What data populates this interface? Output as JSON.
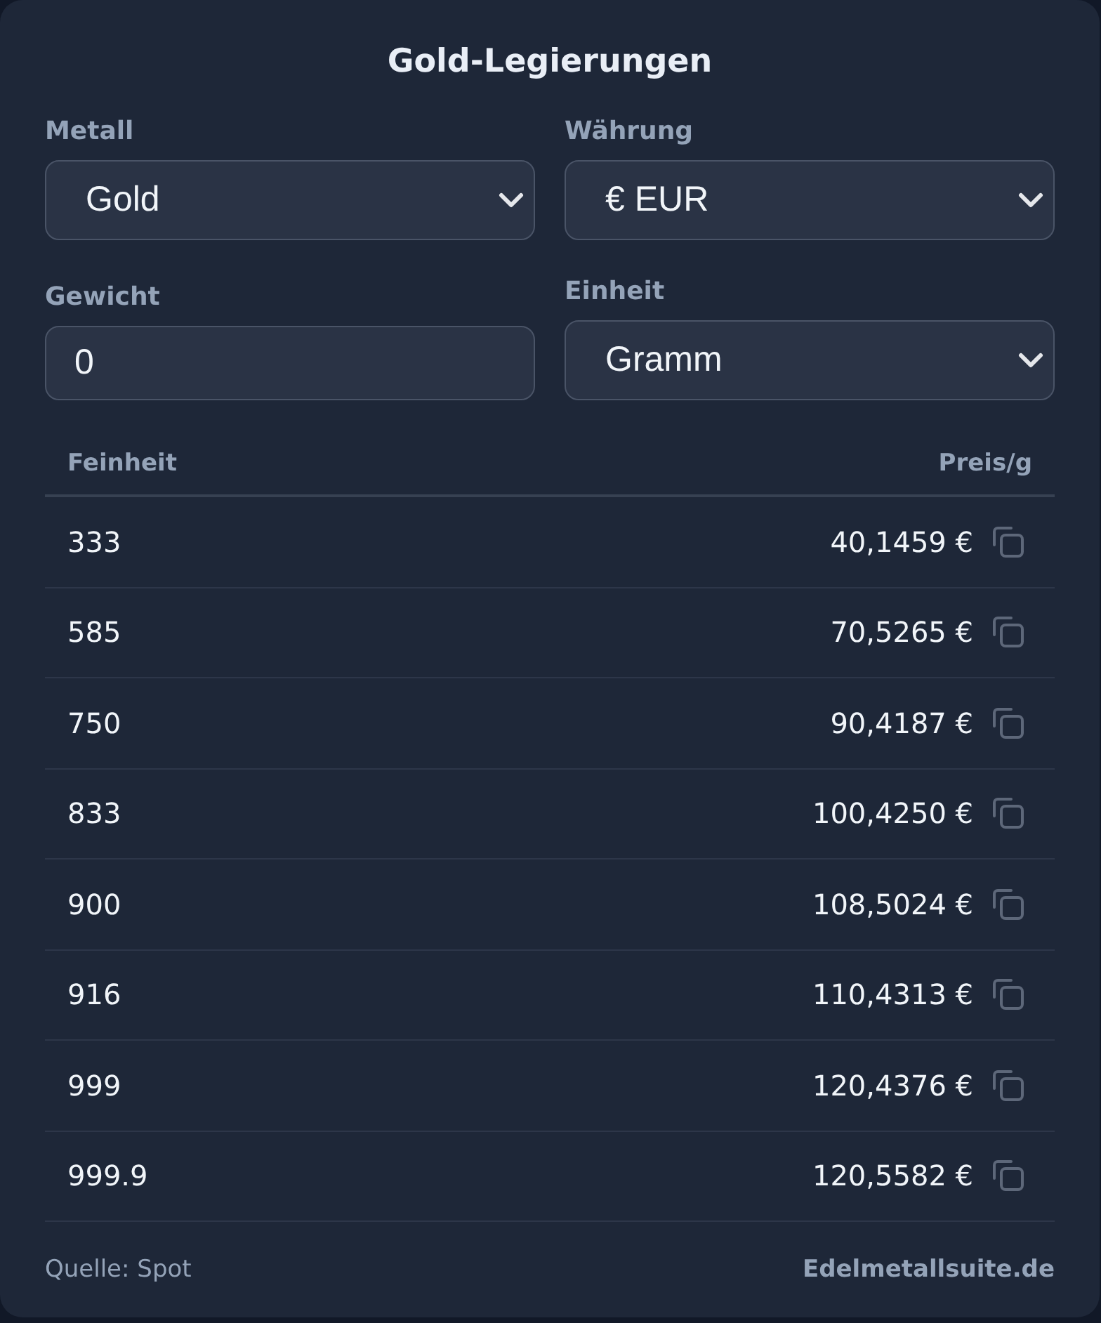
{
  "title": "Gold-Legierungen",
  "fields": [
    {
      "kind": "select",
      "label": "Metall",
      "value": "Gold"
    },
    {
      "kind": "select",
      "label": "Währung",
      "value": "€ EUR"
    },
    {
      "kind": "input",
      "label": "Gewicht",
      "value": "0"
    },
    {
      "kind": "select",
      "label": "Einheit",
      "value": "Gramm"
    }
  ],
  "table": {
    "columns": [
      "Feinheit",
      "Preis/g"
    ],
    "rows": [
      {
        "fineness": "333",
        "price": "40,1459 €"
      },
      {
        "fineness": "585",
        "price": "70,5265 €"
      },
      {
        "fineness": "750",
        "price": "90,4187 €"
      },
      {
        "fineness": "833",
        "price": "100,4250 €"
      },
      {
        "fineness": "900",
        "price": "108,5024 €"
      },
      {
        "fineness": "916",
        "price": "110,4313 €"
      },
      {
        "fineness": "999",
        "price": "120,4376 €"
      },
      {
        "fineness": "999.9",
        "price": "120,5582 €"
      }
    ]
  },
  "footer": {
    "source": "Quelle: Spot",
    "link": "Edelmetallsuite.de"
  }
}
